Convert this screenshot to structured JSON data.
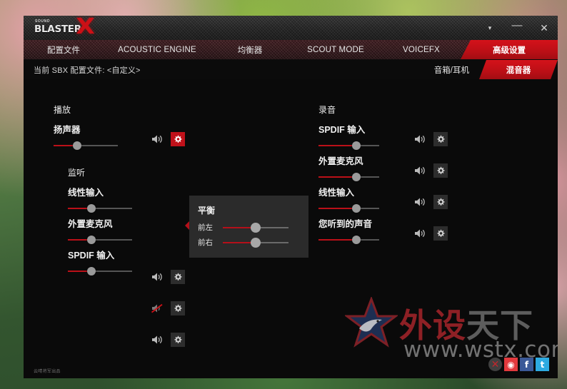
{
  "window": {
    "logo": {
      "top": "SOUND",
      "main": "BLASTER",
      "x": "X"
    },
    "controls": {
      "dropdown": "▾",
      "minimize": "—",
      "close": "✕"
    }
  },
  "nav": {
    "tabs": [
      {
        "label": "配置文件",
        "active": false
      },
      {
        "label": "ACOUSTIC ENGINE",
        "active": false
      },
      {
        "label": "均衡器",
        "active": false
      },
      {
        "label": "SCOUT MODE",
        "active": false
      },
      {
        "label": "VOICEFX",
        "active": false
      },
      {
        "label": "高级设置",
        "active": true
      }
    ]
  },
  "subbar": {
    "profile_text": "当前 SBX 配置文件: <自定义>",
    "modes": [
      {
        "label": "音箱/耳机",
        "active": false
      },
      {
        "label": "混音器",
        "active": true
      }
    ]
  },
  "playback": {
    "heading": "播放",
    "rows": [
      {
        "label": "扬声器",
        "volume": 37,
        "muted": false,
        "gear_active": true
      },
      {
        "label": "监听",
        "is_group_heading": true
      },
      {
        "label": "线性输入",
        "volume": 37,
        "muted": false,
        "gear_active": false
      },
      {
        "label": "外置麦克风",
        "volume": 37,
        "muted": true,
        "gear_active": false
      },
      {
        "label": "SPDIF 输入",
        "volume": 37,
        "muted": false,
        "gear_active": false
      }
    ]
  },
  "recording": {
    "heading": "录音",
    "rows": [
      {
        "label": "SPDIF 输入",
        "volume": 62,
        "muted": false,
        "gear_active": false
      },
      {
        "label": "外置麦克风",
        "volume": 62,
        "muted": false,
        "gear_active": false
      },
      {
        "label": "线性输入",
        "volume": 62,
        "muted": false,
        "gear_active": false
      },
      {
        "label": "您听到的声音",
        "volume": 62,
        "muted": false,
        "gear_active": false
      }
    ]
  },
  "balance_popup": {
    "title": "平衡",
    "rows": [
      {
        "label": "前左",
        "value": 50
      },
      {
        "label": "前右",
        "value": 50
      }
    ]
  },
  "watermark": {
    "text_red": "外设",
    "text_gray": "天下",
    "url": "www.wstx.com",
    "social": [
      {
        "name": "close",
        "glyph": "✕"
      },
      {
        "name": "weibo",
        "glyph": "◉"
      },
      {
        "name": "facebook",
        "glyph": "f"
      },
      {
        "name": "twitter",
        "glyph": "t"
      }
    ]
  },
  "credit": "云晴将军出品",
  "colors": {
    "accent_red": "#bb1018",
    "panel_bg": "#0a0a0a",
    "popup_bg": "#2b2b2b"
  }
}
